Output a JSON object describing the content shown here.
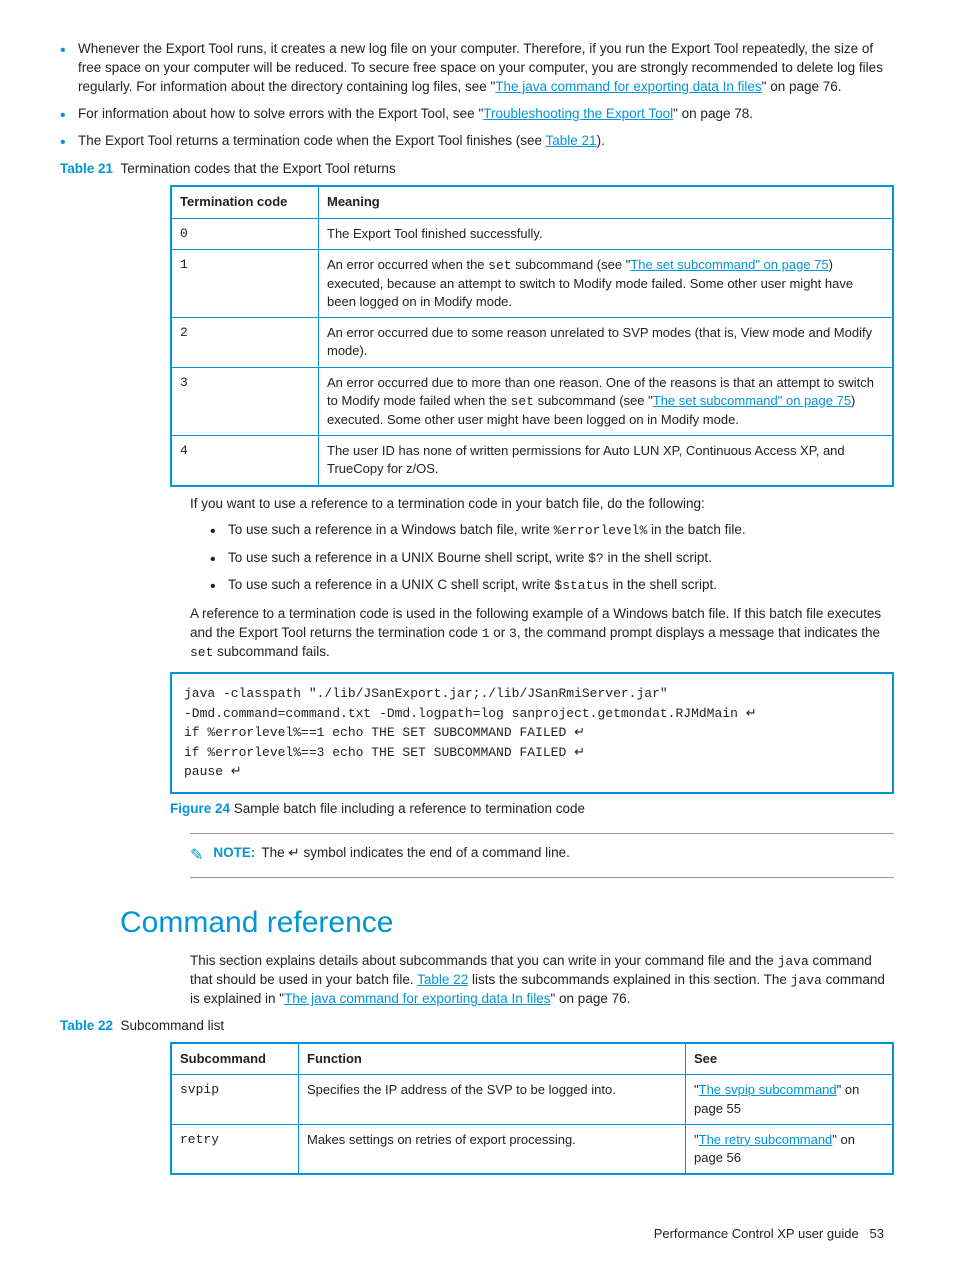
{
  "bullets_top": [
    {
      "pre": "Whenever the Export Tool runs, it creates a new log file on your computer. Therefore, if you run the Export Tool repeatedly, the size of free space on your computer will be reduced. To secure free space on your computer, you are strongly recommended to delete log files regularly. For information about the directory containing log files, see \"",
      "link": "The java command for exporting data In files",
      "post": "\" on page 76."
    },
    {
      "pre": "For information about how to solve errors with the Export Tool, see \"",
      "link": "Troubleshooting the Export Tool",
      "post": "\" on page 78."
    },
    {
      "pre": "The Export Tool returns a termination code when the Export Tool finishes (see ",
      "link": "Table 21",
      "post": ")."
    }
  ],
  "table21": {
    "label": "Table 21",
    "title": "Termination codes that the Export Tool returns",
    "headers": {
      "code": "Termination code",
      "meaning": "Meaning"
    },
    "rows": [
      {
        "code": "0",
        "meaning_pre": "The Export Tool finished successfully.",
        "link": "",
        "meaning_post": ""
      },
      {
        "code": "1",
        "meaning_pre": "An error occurred when the ",
        "code_inline": "set",
        "mid": " subcommand (see \"",
        "link": "The set subcommand\" on page 75",
        "meaning_post": ") executed, because an attempt to switch to Modify mode failed. Some other user might have been logged on in Modify mode."
      },
      {
        "code": "2",
        "meaning_pre": "An error occurred due to some reason unrelated to SVP modes (that is, View mode and Modify mode).",
        "link": "",
        "meaning_post": ""
      },
      {
        "code": "3",
        "meaning_pre": "An error occurred due to more than one reason. One of the reasons is that an attempt to switch to Modify mode failed when the ",
        "code_inline": "set",
        "mid": " subcommand (see \"",
        "link": "The set subcommand\" on page 75",
        "meaning_post": ") executed. Some other user might have been logged on in Modify mode."
      },
      {
        "code": "4",
        "meaning_pre": "The user ID has none of written permissions for Auto LUN XP, Continuous Access XP, and TrueCopy for z/OS.",
        "link": "",
        "meaning_post": ""
      }
    ]
  },
  "after_table_para": "If you want to use a reference to a termination code in your batch file, do the following:",
  "ref_bullets": [
    "To use such a reference in a Windows batch file, write %errorlevel% in the batch file.",
    "To use such a reference in a UNIX Bourne shell script, write $? in the shell script.",
    "To use such a reference in a UNIX C shell script, write $status in the shell script."
  ],
  "example_para": {
    "p1": "A reference to a termination code is used in the following example of a Windows batch file. If this batch file executes and the Export Tool returns the termination code ",
    "c1": "1",
    "p2": " or ",
    "c2": "3",
    "p3": ", the command prompt displays a message that indicates the ",
    "c3": "set",
    "p4": " subcommand fails."
  },
  "codebox": "java -classpath \"./lib/JSanExport.jar;./lib/JSanRmiServer.jar\"\n-Dmd.command=command.txt -Dmd.logpath=log sanproject.getmondat.RJMdMain ↵\nif %errorlevel%==1 echo THE SET SUBCOMMAND FAILED ↵\nif %errorlevel%==3 echo THE SET SUBCOMMAND FAILED ↵\npause ↵",
  "figure24": {
    "label": "Figure 24",
    "title": "Sample batch file including a reference to termination code"
  },
  "note": {
    "label": "NOTE:",
    "text": "The ↵ symbol indicates the end of a command line."
  },
  "heading": "Command reference",
  "cmdref_para": {
    "p1": "This section explains details about subcommands that you can write in your command file and the ",
    "c1": "java",
    "p2": " command that should be used in your batch file. ",
    "link1": "Table 22",
    "p3": " lists the subcommands explained in this section. The ",
    "c2": "java",
    "p4": " command is explained in \"",
    "link2": "The java command for exporting data In files",
    "p5": "\" on page 76."
  },
  "table22": {
    "label": "Table 22",
    "title": "Subcommand list",
    "headers": {
      "sub": "Subcommand",
      "func": "Function",
      "see": "See"
    },
    "rows": [
      {
        "sub": "svpip",
        "func": "Specifies the IP address of the SVP to be logged into.",
        "see_pre": "\"",
        "see_link": "The svpip subcommand",
        "see_post": "\" on page 55"
      },
      {
        "sub": "retry",
        "func": "Makes settings on retries of export processing.",
        "see_pre": "\"",
        "see_link": "The retry subcommand",
        "see_post": "\" on page 56"
      }
    ]
  },
  "footer": {
    "title": "Performance Control XP user guide",
    "page": "53"
  }
}
